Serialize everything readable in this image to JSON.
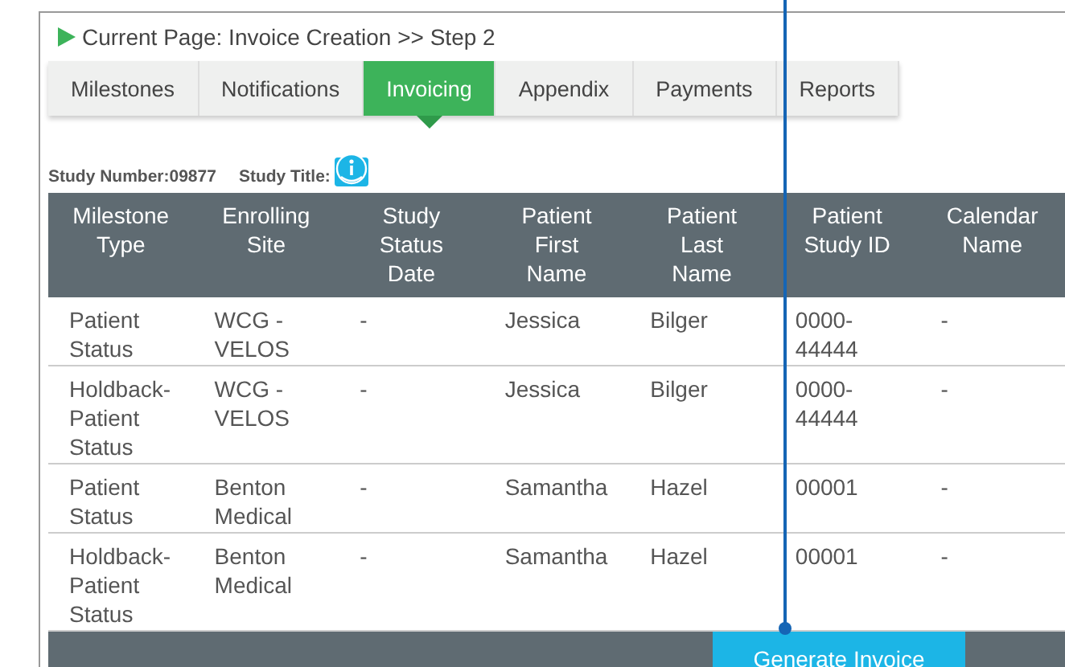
{
  "breadcrumb": "Current Page: Invoice Creation >> Step 2",
  "tabs": [
    {
      "label": "Milestones",
      "selected": false
    },
    {
      "label": "Notifications",
      "selected": false
    },
    {
      "label": "Invoicing",
      "selected": true
    },
    {
      "label": "Appendix",
      "selected": false
    },
    {
      "label": "Payments",
      "selected": false
    },
    {
      "label": "Reports",
      "selected": false
    }
  ],
  "study": {
    "number": "Study Number:09877",
    "title_label": "Study Title:"
  },
  "table": {
    "columns": [
      "Milestone Type",
      "Enrolling Site",
      "Study Status Date",
      "Patient First Name",
      "Patient Last Name",
      "Patient Study ID",
      "Calendar Name"
    ],
    "rows": [
      [
        "Patient Status",
        "WCG - VELOS",
        "-",
        "Jessica",
        "Bilger",
        "0000-44444",
        "-"
      ],
      [
        "Holdback-Patient Status",
        "WCG - VELOS",
        "-",
        "Jessica",
        "Bilger",
        "0000-44444",
        "-"
      ],
      [
        "Patient Status",
        "Benton Medical",
        "-",
        "Samantha",
        "Hazel",
        "00001",
        "-"
      ],
      [
        "Holdback-Patient Status",
        "Benton Medical",
        "-",
        "Samantha",
        "Hazel",
        "00001",
        "-"
      ]
    ]
  },
  "footer": {
    "button": "Generate Invoice"
  }
}
